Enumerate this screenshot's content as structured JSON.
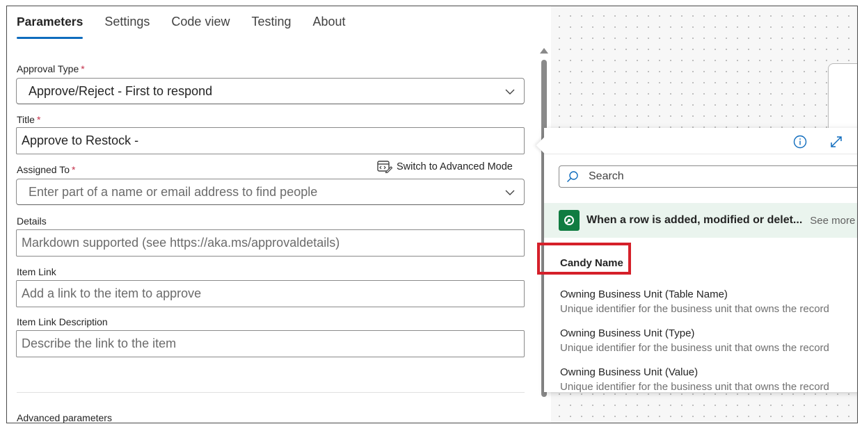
{
  "tabs": [
    "Parameters",
    "Settings",
    "Code view",
    "Testing",
    "About"
  ],
  "form": {
    "approval_type_label": "Approval Type",
    "approval_type_value": "Approve/Reject - First to respond",
    "title_label": "Title",
    "title_value": "Approve to Restock -",
    "assigned_to_label": "Assigned To",
    "assigned_to_placeholder": "Enter part of a name or email address to find people",
    "switch_mode_label": "Switch to Advanced Mode",
    "details_label": "Details",
    "details_placeholder": "Markdown supported (see https://aka.ms/approvaldetails)",
    "item_link_label": "Item Link",
    "item_link_placeholder": "Add a link to the item to approve",
    "item_link_desc_label": "Item Link Description",
    "item_link_desc_placeholder": "Describe the link to the item",
    "advanced_params_label": "Advanced parameters",
    "required_mark": "*"
  },
  "popover": {
    "search_placeholder": "Search",
    "trigger_text": "When a row is added, modified or delet...",
    "see_more": "See more",
    "items": [
      {
        "title": "Candy Name",
        "desc": ""
      },
      {
        "title": "Owning Business Unit (Table Name)",
        "desc": "Unique identifier for the business unit that owns the record"
      },
      {
        "title": "Owning Business Unit (Type)",
        "desc": "Unique identifier for the business unit that owns the record"
      },
      {
        "title": "Owning Business Unit (Value)",
        "desc": "Unique identifier for the business unit that owns the record"
      }
    ]
  },
  "colors": {
    "accent": "#0f6cbd",
    "required": "#c4314b",
    "highlight": "#d5202a",
    "trigger_bg": "#eaf4ee",
    "dataverse_green": "#107c41"
  },
  "icons": [
    "chevron-down-icon",
    "advanced-mode-icon",
    "info-icon",
    "expand-icon",
    "search-icon",
    "dataverse-icon"
  ]
}
